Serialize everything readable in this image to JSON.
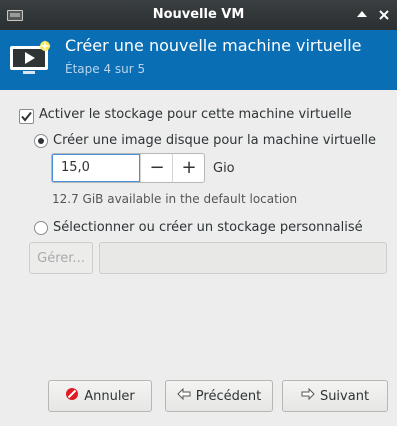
{
  "window": {
    "title": "Nouvelle VM",
    "pin_icon": "pin-icon",
    "close_icon": "close-icon"
  },
  "header": {
    "title": "Créer une nouvelle machine virtuelle",
    "step": "Étape 4 sur 5",
    "background": "#0a6eb5"
  },
  "storage": {
    "enable_label": "Activer le stockage pour cette machine virtuelle",
    "enable_checked": true,
    "create_disk_label": "Créer une image disque pour la machine virtuelle",
    "create_disk_selected": true,
    "disk_size_value": "15,0",
    "disk_size_unit": "Gio",
    "decrement_symbol": "−",
    "increment_symbol": "+",
    "available_text": "12.7 GiB available in the default location",
    "custom_label": "Sélectionner ou créer un stockage personnalisé",
    "custom_selected": false,
    "browse_label": "Gérer...",
    "path_value": ""
  },
  "footer": {
    "cancel_label": "Annuler",
    "back_label": "Précédent",
    "next_label": "Suivant"
  },
  "colors": {
    "accent": "#0a6eb5",
    "cancel_icon": "#e01b24"
  }
}
